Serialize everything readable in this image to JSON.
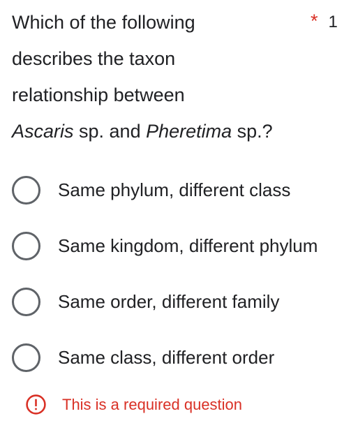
{
  "question": {
    "line1": "Which of the following",
    "line2": "describes the taxon",
    "line3": "relationship between",
    "genus1": "Ascaris",
    "mid": " sp. and ",
    "genus2": "Pheretima",
    "tail": " sp.?",
    "required_star": "*",
    "points": "1"
  },
  "options": [
    {
      "label": "Same phylum, different class",
      "selected": false
    },
    {
      "label": "Same kingdom, different phylum",
      "selected": false
    },
    {
      "label": "Same order, different family",
      "selected": false
    },
    {
      "label": "Same class, different order",
      "selected": false
    }
  ],
  "validation": {
    "message": "This is a required question",
    "icon": "exclamation-circle-icon",
    "color": "#d93025"
  },
  "colors": {
    "text": "#202124",
    "radio_border": "#5f6368",
    "error": "#d93025"
  }
}
